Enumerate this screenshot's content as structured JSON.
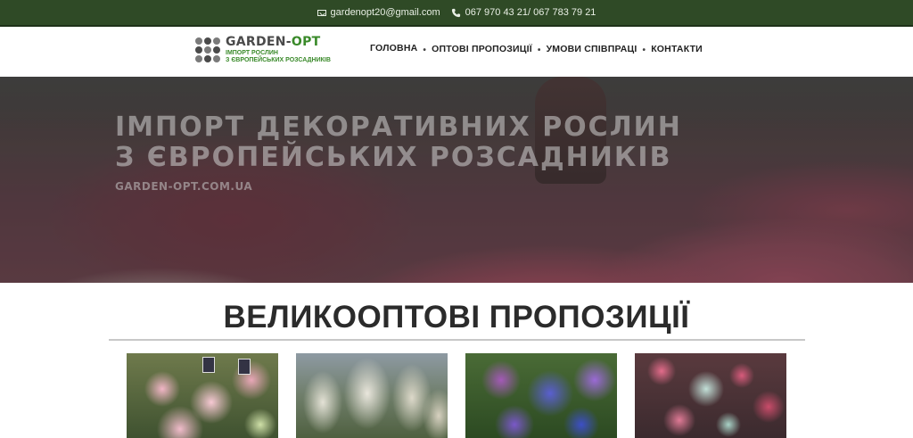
{
  "topbar": {
    "email": "gardenopt20@gmail.com",
    "phones": "067 970 43 21/ 067 783 79 21",
    "email_icon": "mail-icon",
    "phone_icon": "phone-icon",
    "background": "#2f4a26"
  },
  "logo": {
    "title_main": "GARDEN-",
    "title_accent": "OPT",
    "subtitle_line1": "ІМПОРТ РОСЛИН",
    "subtitle_line2": "З ЄВРОПЕЙСЬКИХ РОЗСАДНИКІВ",
    "accent_color": "#3a8a2a"
  },
  "nav": {
    "items": [
      {
        "label": "ГОЛОВНА"
      },
      {
        "label": "ОПТОВІ ПРОПОЗИЦІЇ"
      },
      {
        "label": "УМОВИ СПІВПРАЦІ"
      },
      {
        "label": "КОНТАКТИ"
      }
    ],
    "separator": "•"
  },
  "hero": {
    "title_line1": "ІМПОРТ ДЕКОРАТИВНИХ РОСЛИН",
    "title_line2": "З ЄВРОПЕЙСЬКИХ РОЗСАДНИКІВ",
    "domain": "GARDEN-OPT.COM.UA"
  },
  "section": {
    "title": "ВЕЛИКООПТОВІ ПРОПОЗИЦІЇ"
  },
  "products": [
    {
      "name": "pink-hydrangea-photo"
    },
    {
      "name": "white-hydrangea-photo"
    },
    {
      "name": "blue-hydrangea-photo"
    },
    {
      "name": "pink-green-hydrangea-photo"
    }
  ]
}
